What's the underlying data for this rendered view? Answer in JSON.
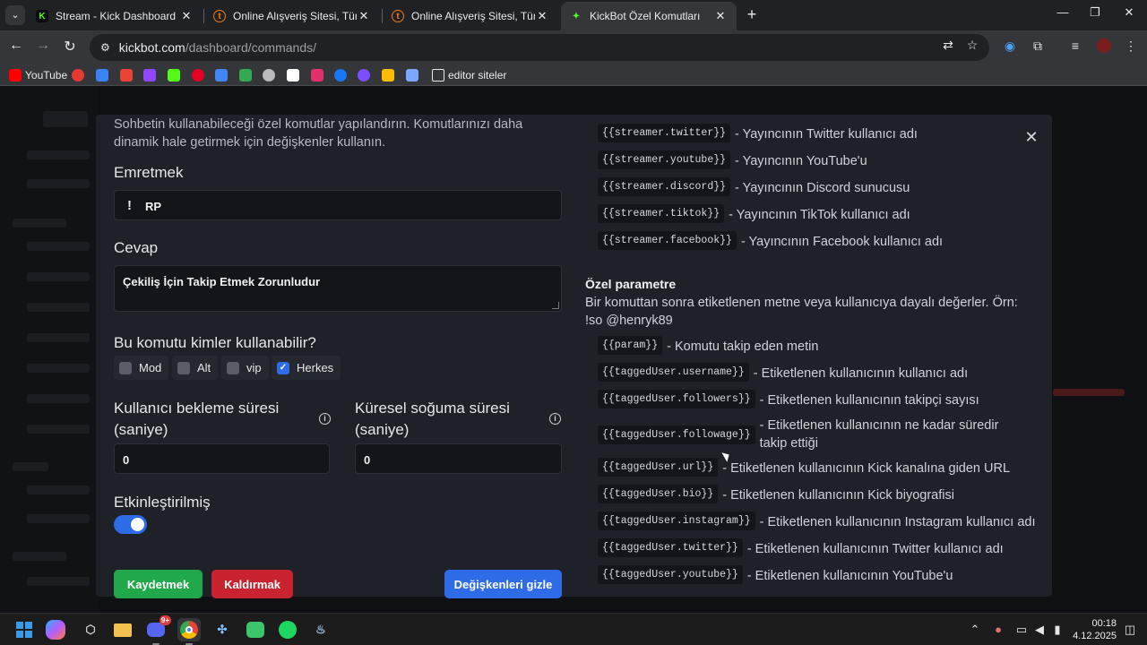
{
  "browser": {
    "tabs": [
      {
        "title": "Stream - Kick Dashboard",
        "favicon": "kick-icon",
        "active": false
      },
      {
        "title": "Online Alışveriş Sitesi, Türkiye'nin",
        "favicon": "trendyol-icon",
        "active": false
      },
      {
        "title": "Online Alışveriş Sitesi, Türkiye'nin",
        "favicon": "trendyol-icon",
        "active": false
      },
      {
        "title": "KickBot Özel Komutları",
        "favicon": "kickbot-icon",
        "active": true
      }
    ],
    "url_host": "kickbot.com",
    "url_path": "/dashboard/commands/",
    "bookmarks": [
      {
        "label": "YouTube",
        "icon": "youtube-icon",
        "color": "#ff0000"
      },
      {
        "label": "",
        "icon": "music-icon",
        "color": "#e53935"
      },
      {
        "label": "",
        "icon": "app-icon",
        "color": "#3b82f6"
      },
      {
        "label": "",
        "icon": "gmail-icon",
        "color": "#ea4335"
      },
      {
        "label": "",
        "icon": "twitch-icon",
        "color": "#9146ff"
      },
      {
        "label": "",
        "icon": "kick-icon",
        "color": "#53fc18"
      },
      {
        "label": "",
        "icon": "pinterest-icon",
        "color": "#e60023"
      },
      {
        "label": "",
        "icon": "translate-icon",
        "color": "#4285f4"
      },
      {
        "label": "",
        "icon": "play-icon",
        "color": "#34a853"
      },
      {
        "label": "",
        "icon": "headphones-icon",
        "color": "#bbbbbb"
      },
      {
        "label": "",
        "icon": "x-icon",
        "color": "#ffffff"
      },
      {
        "label": "",
        "icon": "instagram-icon",
        "color": "#e1306c"
      },
      {
        "label": "",
        "icon": "facebook-icon",
        "color": "#1877f2"
      },
      {
        "label": "",
        "icon": "moon-icon",
        "color": "#7c4dff"
      },
      {
        "label": "",
        "icon": "colors-icon",
        "color": "#fbbc04"
      },
      {
        "label": "",
        "icon": "network-icon",
        "color": "#7aa7ff"
      },
      {
        "label": "editor siteler",
        "icon": "folder-icon",
        "color": "#e8eaed"
      }
    ]
  },
  "form": {
    "description": "Sohbetin kullanabileceği özel komutlar yapılandırın. Komutlarınızı daha dinamik hale getirmek için değişkenler kullanın.",
    "command_label": "Emretmek",
    "command_prefix": "!",
    "command_value": "RP",
    "response_label": "Cevap",
    "response_value": "Çekiliş İçin Takip Etmek Zorunludur",
    "who_label": "Bu komutu kimler kullanabilir?",
    "roles": [
      {
        "label": "Mod",
        "checked": false
      },
      {
        "label": "Alt",
        "checked": false
      },
      {
        "label": "vip",
        "checked": false
      },
      {
        "label": "Herkes",
        "checked": true
      }
    ],
    "user_cooldown_label_1": "Kullanıcı bekleme süresi",
    "user_cooldown_label_2": "(saniye)",
    "user_cooldown_value": "0",
    "global_cooldown_label_1": "Küresel soğuma süresi",
    "global_cooldown_label_2": "(saniye)",
    "global_cooldown_value": "0",
    "enabled_label": "Etkinleştirilmiş",
    "enabled": true,
    "save_label": "Kaydetmek",
    "remove_label": "Kaldırmak",
    "hide_vars_label": "Değişkenleri gizle"
  },
  "colors": {
    "save": "#20a84a",
    "remove": "#c8232f",
    "hide_vars": "#2e6be6"
  },
  "variables": {
    "streamer": [
      {
        "code": "{{streamer.twitter}}",
        "desc": "- Yayıncının Twitter kullanıcı adı"
      },
      {
        "code": "{{streamer.youtube}}",
        "desc": "- Yayıncının YouTube'u"
      },
      {
        "code": "{{streamer.discord}}",
        "desc": "- Yayıncının Discord sunucusu"
      },
      {
        "code": "{{streamer.tiktok}}",
        "desc": "- Yayıncının TikTok kullanıcı adı"
      },
      {
        "code": "{{streamer.facebook}}",
        "desc": "- Yayıncının Facebook kullanıcı adı"
      }
    ],
    "special_title": "Özel parametre",
    "special_desc": "Bir komuttan sonra etiketlenen metne veya kullanıcıya dayalı değerler. Örn: !so @henryk89",
    "params": [
      {
        "code": "{{param}}",
        "desc": "- Komutu takip eden metin"
      },
      {
        "code": "{{taggedUser.username}}",
        "desc": "- Etiketlenen kullanıcının kullanıcı adı"
      },
      {
        "code": "{{taggedUser.followers}}",
        "desc": "- Etiketlenen kullanıcının takipçi sayısı"
      },
      {
        "code": "{{taggedUser.followage}}",
        "desc": "- Etiketlenen kullanıcının ne kadar süredir takip ettiği"
      },
      {
        "code": "{{taggedUser.url}}",
        "desc": "- Etiketlenen kullanıcının Kick kanalına giden URL"
      },
      {
        "code": "{{taggedUser.bio}}",
        "desc": "- Etiketlenen kullanıcının Kick biyografisi"
      },
      {
        "code": "{{taggedUser.instagram}}",
        "desc": "- Etiketlenen kullanıcının Instagram kullanıcı adı"
      },
      {
        "code": "{{taggedUser.twitter}}",
        "desc": "- Etiketlenen kullanıcının Twitter kullanıcı adı"
      },
      {
        "code": "{{taggedUser.youtube}}",
        "desc": "- Etiketlenen kullanıcının YouTube'u"
      }
    ]
  },
  "taskbar": {
    "time": "00:18",
    "date": "4.12.2025",
    "notification_badge": "9+"
  }
}
